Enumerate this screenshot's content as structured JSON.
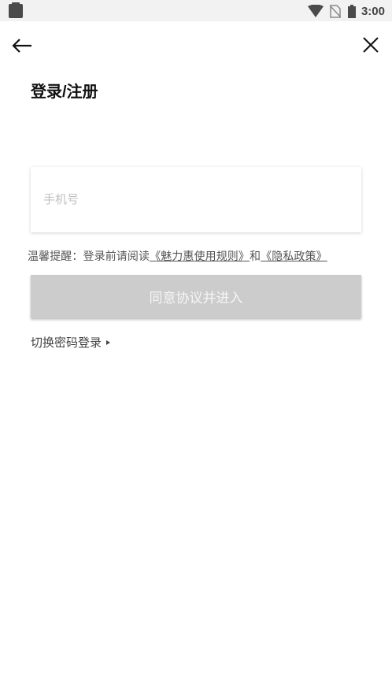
{
  "status_bar": {
    "time": "3:00",
    "icons": [
      "clipboard-icon",
      "wifi-icon",
      "no-sim-icon",
      "battery-icon"
    ]
  },
  "nav": {
    "back_icon": "arrow-left-icon",
    "close_icon": "close-icon"
  },
  "page": {
    "title": "登录/注册"
  },
  "form": {
    "phone_placeholder": "手机号",
    "phone_value": ""
  },
  "notice": {
    "prefix": "温馨提醒：登录前请阅读",
    "terms_link": "《魅力惠使用规则》",
    "connector": "和",
    "privacy_link": "《隐私政策》"
  },
  "actions": {
    "agree_label": "同意协议并进入",
    "switch_login_label": "切换密码登录"
  },
  "colors": {
    "button_disabled_bg": "#cccccc",
    "button_text": "#f5f5f5",
    "status_bar_bg": "#f2f2f2"
  }
}
